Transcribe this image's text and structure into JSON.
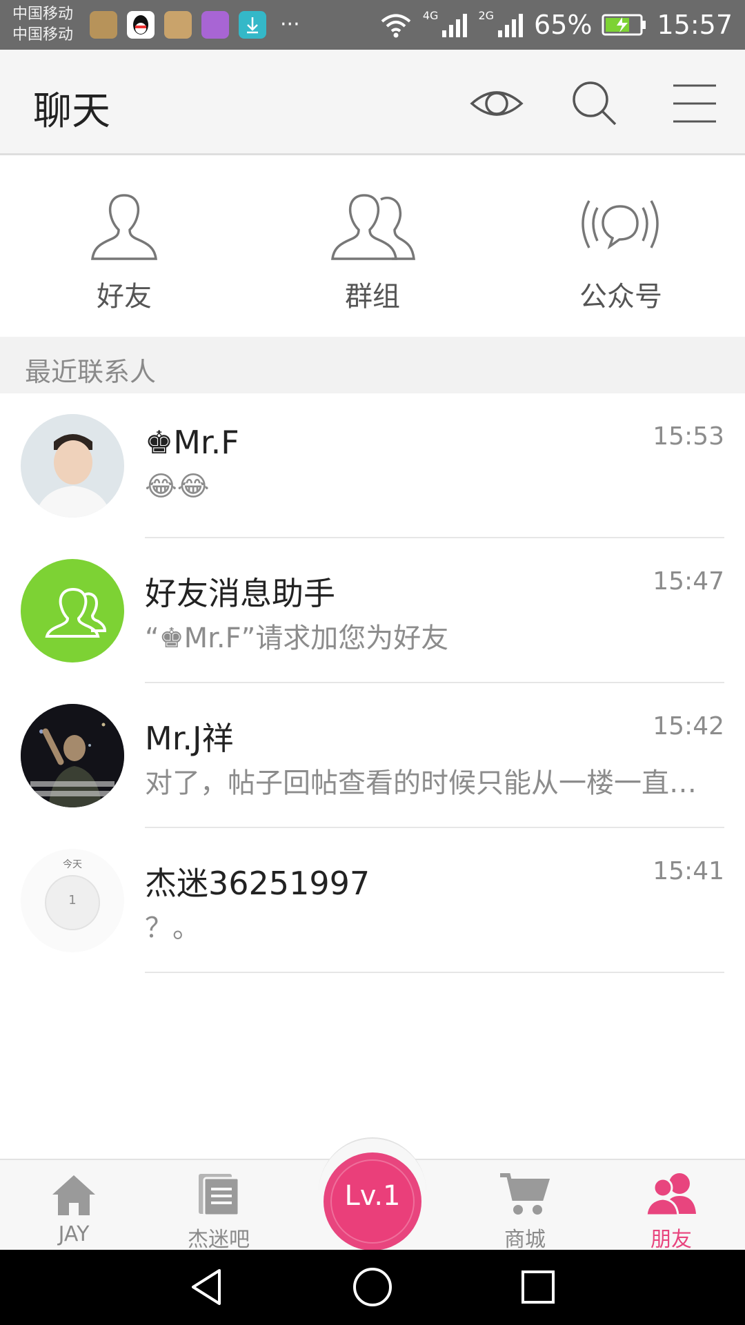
{
  "status_bar": {
    "carrier_1": "中国移动",
    "carrier_2": "中国移动",
    "more": "···",
    "network_1": "4G",
    "network_2": "2G",
    "battery": "65%",
    "time": "15:57"
  },
  "header": {
    "title": "聊天",
    "icons": [
      "eye-icon",
      "search-icon",
      "menu-icon"
    ]
  },
  "quick_actions": [
    {
      "label": "好友",
      "icon": "friend-icon"
    },
    {
      "label": "群组",
      "icon": "group-icon"
    },
    {
      "label": "公众号",
      "icon": "official-account-icon"
    }
  ],
  "section": {
    "title": "最近联系人"
  },
  "conversations": [
    {
      "name": "♚Mr.F",
      "message": "😂😂",
      "time": "15:53"
    },
    {
      "name": "好友消息助手",
      "message": "“♚Mr.F”请求加您为好友",
      "time": "15:47"
    },
    {
      "name": "Mr.J祥",
      "message": "对了，帖子回帖查看的时候只能从一楼一直…",
      "time": "15:42"
    },
    {
      "name": "杰迷36251997",
      "message": "？。",
      "time": "15:41",
      "avatar_text": "今天",
      "avatar_day": "1"
    }
  ],
  "bottom_nav": {
    "items": [
      {
        "label": "JAY",
        "icon": "home-icon"
      },
      {
        "label": "杰迷吧",
        "icon": "forum-icon"
      },
      {
        "label": "商城",
        "icon": "cart-icon"
      },
      {
        "label": "朋友",
        "icon": "friends-icon"
      }
    ],
    "level": "Lv.1",
    "accent": "#e8457e"
  },
  "colors": {
    "accent_pink": "#e8457e",
    "assistant_green": "#7dd234",
    "status_bar": "#6b6b6b",
    "header_bg": "#f5f5f5"
  }
}
